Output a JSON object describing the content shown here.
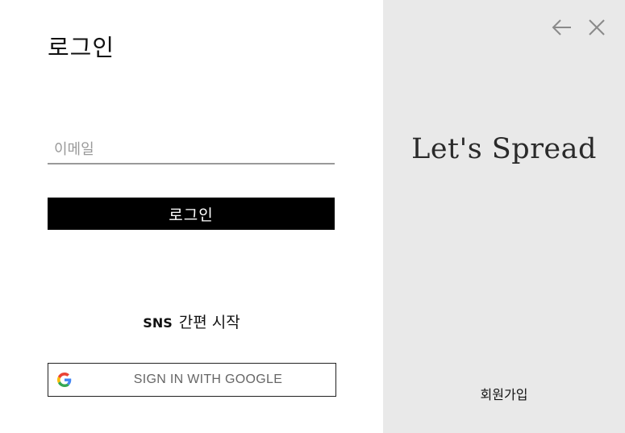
{
  "login": {
    "title": "로그인",
    "email_placeholder": "이메일",
    "email_value": "",
    "login_button_label": "로그인",
    "sns_prefix": "SNS",
    "sns_suffix": "간편 시작",
    "google_button_label": "SIGN IN WITH GOOGLE"
  },
  "side": {
    "slogan": "Let's Spread",
    "signup_label": "회원가입"
  },
  "icons": {
    "back": "arrow-left-icon",
    "close": "close-icon",
    "google": "google-logo-icon"
  },
  "colors": {
    "button_bg": "#000000",
    "side_bg": "#e9e9e9",
    "google_blue": "#4285F4",
    "google_red": "#EA4335",
    "google_yellow": "#FBBC05",
    "google_green": "#34A853"
  }
}
